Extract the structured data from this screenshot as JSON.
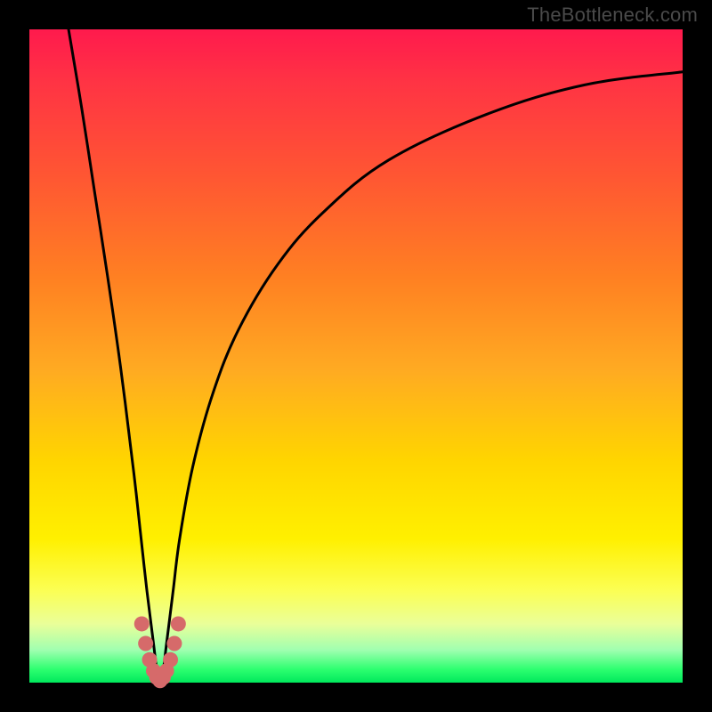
{
  "watermark": "TheBottleneck.com",
  "frame": {
    "outer_w": 800,
    "outer_h": 800,
    "margin": 33
  },
  "chart_data": {
    "type": "line",
    "title": "",
    "xlabel": "",
    "ylabel": "",
    "xlim": [
      0,
      100
    ],
    "ylim": [
      0,
      100
    ],
    "grid": false,
    "legend": false,
    "series": [
      {
        "name": "bottleneck-curve",
        "color": "#000000",
        "x": [
          6,
          8,
          10,
          12,
          14,
          16,
          17,
          18,
          19,
          19.5,
          20,
          20.5,
          21,
          22,
          23,
          25,
          28,
          32,
          38,
          45,
          55,
          70,
          85,
          100
        ],
        "y": [
          100,
          88,
          75,
          62,
          48,
          32,
          23,
          14,
          6,
          2,
          0,
          2,
          6,
          14,
          22,
          33,
          44,
          54,
          64,
          72,
          80,
          87,
          91.5,
          93.5
        ]
      },
      {
        "name": "trough-highlight",
        "color": "#d66a6a",
        "x": [
          17.2,
          17.8,
          18.4,
          19.0,
          19.5,
          20.0,
          20.5,
          21.0,
          21.6,
          22.2,
          22.8
        ],
        "y": [
          9,
          6,
          3.5,
          1.8,
          0.8,
          0.3,
          0.8,
          1.8,
          3.5,
          6,
          9
        ]
      }
    ],
    "background_gradient": {
      "top": "#ff1a4d",
      "mid": "#ffd500",
      "bottom": "#00e85c"
    }
  }
}
